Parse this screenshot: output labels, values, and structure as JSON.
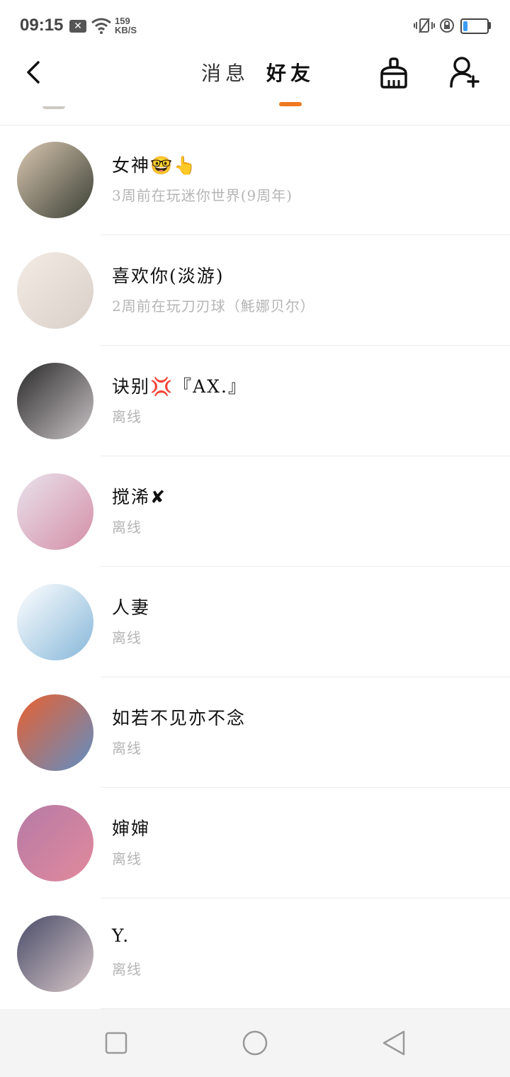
{
  "status_bar": {
    "time": "09:15",
    "notif_icon": "x-box-icon",
    "net_speed_value": "159",
    "net_speed_unit": "KB/S",
    "battery_percent": 0.2
  },
  "header": {
    "tabs": [
      {
        "label": "消息",
        "active": false
      },
      {
        "label": "好友",
        "active": true
      }
    ],
    "accent_color": "#f07820"
  },
  "friends": [
    {
      "name": "女神🤓👆",
      "status": "3周前在玩迷你世界(9周年)",
      "avatar_colors": [
        "#d9c7b0",
        "#3a3f35"
      ]
    },
    {
      "name": "喜欢你(淡游)",
      "status": "2周前在玩刀刃球（魹娜贝尔）",
      "avatar_colors": [
        "#f3ece4",
        "#d8cfc8"
      ]
    },
    {
      "name": "诀别💢『AX.』",
      "status": "离线",
      "avatar_colors": [
        "#2a2a2a",
        "#c9c3c6"
      ]
    },
    {
      "name": "搅浠✘",
      "status": "离线",
      "avatar_colors": [
        "#e9e2ec",
        "#d48fa6"
      ]
    },
    {
      "name": "人妻",
      "status": "离线",
      "avatar_colors": [
        "#ffffff",
        "#86b7d9"
      ]
    },
    {
      "name": "如若不见亦不念",
      "status": "离线",
      "avatar_colors": [
        "#e9602f",
        "#5f8fc6"
      ]
    },
    {
      "name": "婶婶",
      "status": "离线",
      "avatar_colors": [
        "#b57aa6",
        "#e28a9c"
      ]
    },
    {
      "name": "Y.",
      "status": "离线",
      "avatar_colors": [
        "#4a4c6a",
        "#d7c7c7"
      ]
    }
  ]
}
